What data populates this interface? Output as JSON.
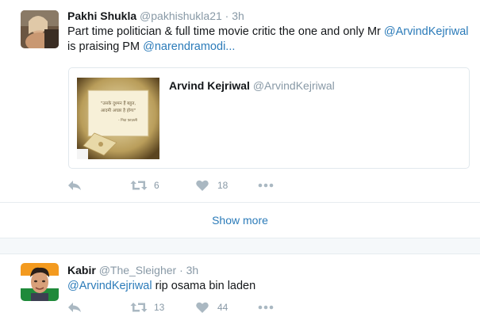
{
  "tweets": [
    {
      "name": "Pakhi Shukla",
      "handle": "@pakhishukla21",
      "separator": "·",
      "time": "3h",
      "text_parts": [
        "Part time politician & full time movie critic the one and only Mr ",
        "@ArvindKejriwal",
        " is praising PM ",
        "@narendramodi",
        "..."
      ],
      "quote": {
        "name": "Arvind Kejriwal",
        "handle": "@ArvindKejriwal",
        "image_text_line1": "\"उसके दुश्मन हैं बहुत,",
        "image_text_line2": "आदमी अच्छा है होगा\"",
        "image_text_line3": "- निदा फ़ाज़ली"
      },
      "actions": {
        "reply_icon": "reply-icon",
        "retweet_count": "6",
        "like_count": "18",
        "more_icon": "more-icon"
      }
    },
    {
      "name": "Kabir",
      "handle": "@The_Sleigher",
      "separator": "·",
      "time": "3h",
      "text_parts": [
        "@ArvindKejriwal",
        " rip osama bin laden"
      ],
      "actions": {
        "reply_icon": "reply-icon",
        "retweet_count": "13",
        "like_count": "44",
        "more_icon": "more-icon"
      }
    }
  ],
  "show_more": "Show more",
  "colors": {
    "link": "#2b7bb9",
    "muted": "#8899a6",
    "icon": "#aab8c2",
    "divider": "#e6ecf0"
  }
}
